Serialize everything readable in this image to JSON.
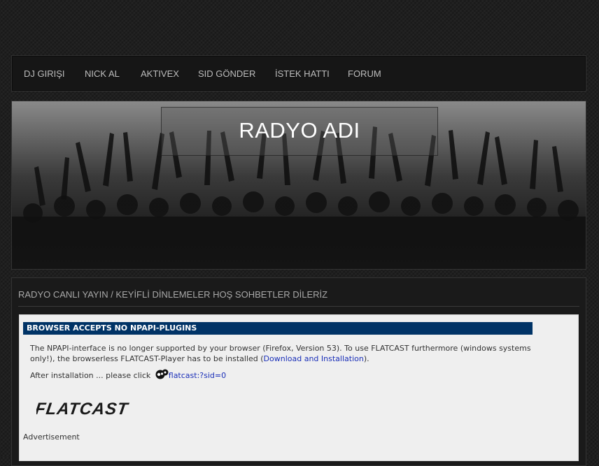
{
  "nav": {
    "items": [
      {
        "label": "DJ GIRIŞI"
      },
      {
        "label": "NICK AL"
      },
      {
        "label": "AKTIVEX"
      },
      {
        "label": "SID GÖNDER"
      },
      {
        "label": "İSTEK HATTI"
      },
      {
        "label": "FORUM"
      }
    ]
  },
  "banner": {
    "title": "RADYO ADI"
  },
  "content": {
    "tagline": "RADYO CANLI YAYIN / KEYİFLİ DİNLEMELER HOŞ SOHBETLER DİLERİZ"
  },
  "plugin": {
    "header": "BROWSER ACCEPTS NO NPAPI-PLUGINS",
    "message_part1": "The NPAPI-interface is no longer supported by your browser (Firefox, Version 53). To use FLATCAST furthermore (windows systems only!), the browserless FLATCAST-Player has to be installed (",
    "download_link": "Download and Installation",
    "message_part2": ").",
    "after_install": "After installation ... please click",
    "flatcast_link": "flatcast:?sid=0",
    "logo_text": "FLATCAST",
    "ad_label": "Advertisement"
  },
  "colors": {
    "header_blue": "#003366",
    "link_blue": "#1a2fb8",
    "nav_text": "#bdbdbd"
  }
}
